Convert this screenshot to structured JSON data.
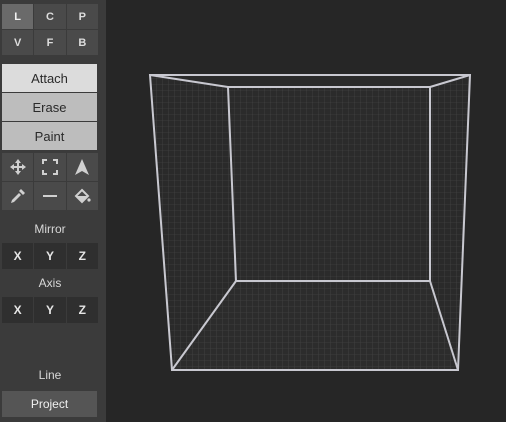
{
  "view_buttons": [
    "L",
    "C",
    "P",
    "V",
    "F",
    "B"
  ],
  "modes": [
    "Attach",
    "Erase",
    "Paint"
  ],
  "tool_icons": [
    "move-icon",
    "select-box-icon",
    "cursor-icon",
    "eyedropper-icon",
    "line-icon",
    "fill-bucket-icon"
  ],
  "mirror": {
    "label": "Mirror",
    "buttons": [
      "X",
      "Y",
      "Z"
    ]
  },
  "axis": {
    "label": "Axis",
    "buttons": [
      "X",
      "Y",
      "Z"
    ]
  },
  "footer": {
    "line_label": "Line",
    "project_label": "Project"
  },
  "colors": {
    "sidebar": "#3b3b3b",
    "viewport": "#262626",
    "wire": "#c8c8d0"
  }
}
